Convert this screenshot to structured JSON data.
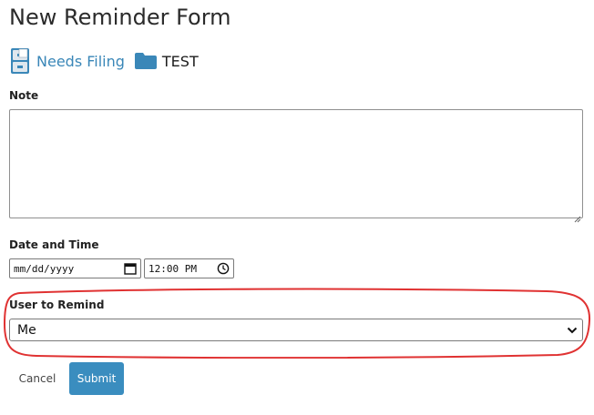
{
  "page": {
    "title": "New Reminder Form"
  },
  "breadcrumb": {
    "filing_label": "Needs Filing",
    "folder_label": "TEST",
    "icon_names": [
      "filing-cabinet-icon",
      "folder-icon"
    ],
    "accent_color": "#3a87b8"
  },
  "form": {
    "note": {
      "label": "Note",
      "value": ""
    },
    "datetime": {
      "label": "Date and Time",
      "date_placeholder": "mm/dd/yyyy",
      "time_value": "12:00 PM"
    },
    "user": {
      "label": "User to Remind",
      "selected": "Me"
    },
    "buttons": {
      "cancel": "Cancel",
      "submit": "Submit",
      "submit_color": "#3a8dbf"
    },
    "highlight_color": "#e03232"
  }
}
